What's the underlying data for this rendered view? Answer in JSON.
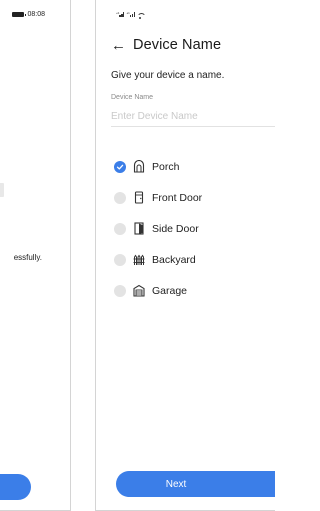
{
  "left_screen": {
    "status_time": "08:08",
    "message_fragment": "essfully."
  },
  "right_screen": {
    "status": {
      "cellular_1": "⁴⁶",
      "cellular_2": "⁴⁶"
    },
    "header": {
      "title": "Device Name",
      "back_icon": "arrow-left-icon"
    },
    "subtitle": "Give your device a name.",
    "name_field": {
      "label": "Device Name",
      "placeholder": "Enter Device Name",
      "value": ""
    },
    "options": [
      {
        "label": "Porch",
        "icon": "porch-icon",
        "selected": true
      },
      {
        "label": "Front Door",
        "icon": "front-door-icon",
        "selected": false
      },
      {
        "label": "Side Door",
        "icon": "side-door-icon",
        "selected": false
      },
      {
        "label": "Backyard",
        "icon": "backyard-fence-icon",
        "selected": false
      },
      {
        "label": "Garage",
        "icon": "garage-icon",
        "selected": false
      }
    ],
    "next_label": "Next"
  },
  "colors": {
    "accent": "#3b7ee8",
    "radio_unselected": "#e3e3e3",
    "divider": "#e2e2e2"
  }
}
